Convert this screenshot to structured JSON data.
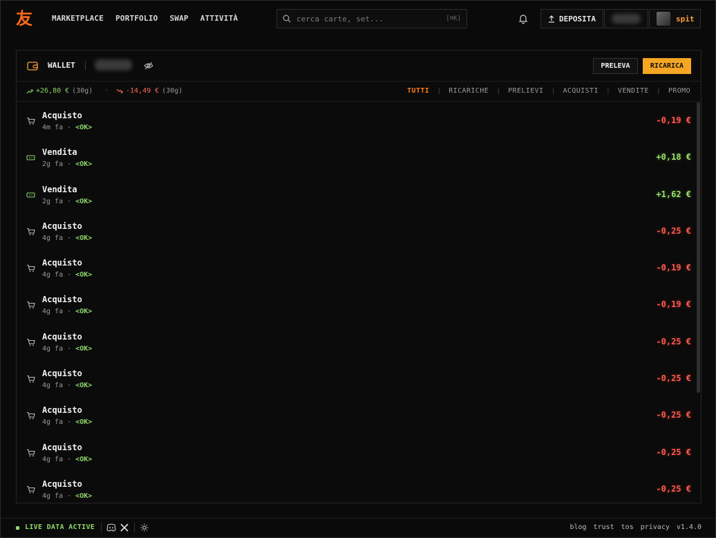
{
  "brand": {
    "logo": "友"
  },
  "nav": [
    "MARKETPLACE",
    "PORTFOLIO",
    "SWAP",
    "ATTIVITÀ"
  ],
  "search": {
    "placeholder": "cerca carte, set...",
    "shortcut": "[⌘K]"
  },
  "header": {
    "deposit_label": "DEPOSITA",
    "username": "spit"
  },
  "wallet": {
    "title": "WALLET",
    "withdraw_label": "PRELEVA",
    "recharge_label": "RICARICA",
    "stats": {
      "in_amount": "+26,80 €",
      "in_period": "(30g)",
      "separator": "·",
      "out_amount": "-14,49 €",
      "out_period": "(30g)"
    },
    "filters": [
      "TUTTI",
      "RICARICHE",
      "PRELIEVI",
      "ACQUISTI",
      "VENDITE",
      "PROMO"
    ],
    "active_filter": "TUTTI",
    "transactions": [
      {
        "type": "Acquisto",
        "icon": "cart-icon",
        "time": "4m fa",
        "status": "<OK>",
        "amount": "-0,19 €",
        "sign": "neg"
      },
      {
        "type": "Vendita",
        "icon": "ticket-icon",
        "time": "2g fa",
        "status": "<OK>",
        "amount": "+0,18 €",
        "sign": "pos"
      },
      {
        "type": "Vendita",
        "icon": "ticket-icon",
        "time": "2g fa",
        "status": "<OK>",
        "amount": "+1,62 €",
        "sign": "pos"
      },
      {
        "type": "Acquisto",
        "icon": "cart-icon",
        "time": "4g fa",
        "status": "<OK>",
        "amount": "-0,25 €",
        "sign": "neg"
      },
      {
        "type": "Acquisto",
        "icon": "cart-icon",
        "time": "4g fa",
        "status": "<OK>",
        "amount": "-0,19 €",
        "sign": "neg"
      },
      {
        "type": "Acquisto",
        "icon": "cart-icon",
        "time": "4g fa",
        "status": "<OK>",
        "amount": "-0,19 €",
        "sign": "neg"
      },
      {
        "type": "Acquisto",
        "icon": "cart-icon",
        "time": "4g fa",
        "status": "<OK>",
        "amount": "-0,25 €",
        "sign": "neg"
      },
      {
        "type": "Acquisto",
        "icon": "cart-icon",
        "time": "4g fa",
        "status": "<OK>",
        "amount": "-0,25 €",
        "sign": "neg"
      },
      {
        "type": "Acquisto",
        "icon": "cart-icon",
        "time": "4g fa",
        "status": "<OK>",
        "amount": "-0,25 €",
        "sign": "neg"
      },
      {
        "type": "Acquisto",
        "icon": "cart-icon",
        "time": "4g fa",
        "status": "<OK>",
        "amount": "-0,25 €",
        "sign": "neg"
      },
      {
        "type": "Acquisto",
        "icon": "cart-icon",
        "time": "4g fa",
        "status": "<OK>",
        "amount": "-0,25 €",
        "sign": "neg"
      }
    ]
  },
  "footer": {
    "live_label": "LIVE DATA ACTIVE",
    "links": [
      "blog",
      "trust",
      "tos",
      "privacy"
    ],
    "version": "v1.4.0"
  },
  "colors": {
    "accent": "#ff7a1a",
    "positive": "#8ed66a",
    "negative": "#ff5a4e",
    "button_primary": "#f5a623"
  }
}
